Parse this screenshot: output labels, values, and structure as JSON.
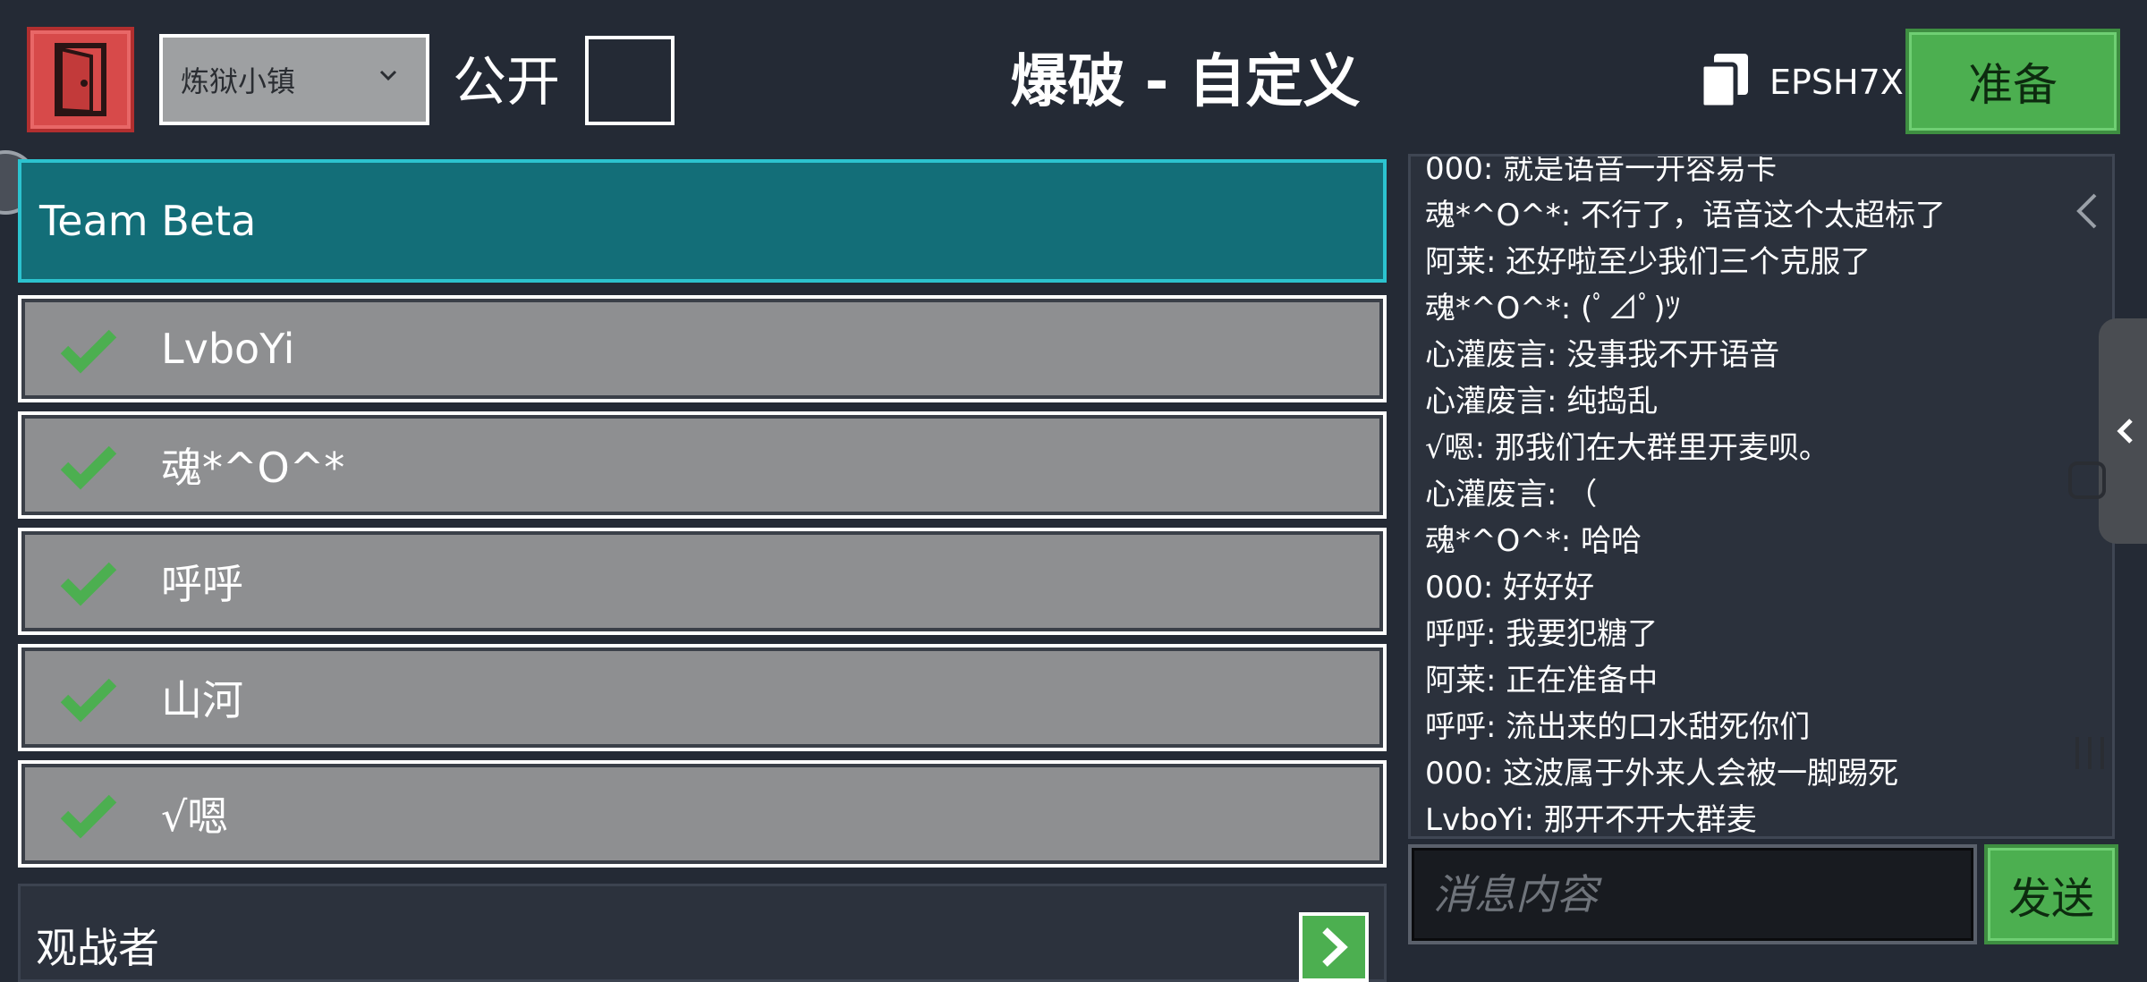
{
  "header": {
    "map_name": "炼狱小镇",
    "public_label": "公开",
    "public_checked": false,
    "mode_title": "爆破 - 自定义",
    "room_code": "EPSH7X",
    "ready_label": "准备"
  },
  "team": {
    "name": "Team Beta",
    "players": [
      {
        "name": "LvboYi",
        "ready": true
      },
      {
        "name": "魂*^O^*",
        "ready": true
      },
      {
        "name": "呼呼",
        "ready": true
      },
      {
        "name": "山河",
        "ready": true
      },
      {
        "name": "√嗯",
        "ready": true
      }
    ]
  },
  "spectators": {
    "label": "观战者"
  },
  "chat": {
    "messages": [
      "000: 就是语音一开容易卡",
      "魂*^O^*: 不行了，语音这个太超标了",
      "阿莱: 还好啦至少我们三个克服了",
      "魂*^O^*: (ﾟ⊿ﾟ)ﾂ",
      "心灌废言: 没事我不开语音",
      "心灌废言: 纯捣乱",
      "√嗯: 那我们在大群里开麦呗。",
      "心灌废言: （",
      "魂*^O^*: 哈哈",
      "000: 好好好",
      "呼呼: 我要犯糖了",
      "阿莱: 正在准备中",
      "呼呼: 流出来的口水甜死你们",
      "000: 这波属于外来人会被一脚踢死",
      "LvboYi: 那开不开大群麦"
    ],
    "input_placeholder": "消息内容",
    "send_label": "发送"
  },
  "colors": {
    "background": "#242a35",
    "team_header": "#136e78",
    "player_row": "#8e8f91",
    "accent_green": "#4caf50",
    "exit_red": "#d74a4a"
  },
  "icons": {
    "exit": "door-exit-icon",
    "copy": "copy-icon",
    "ready_check": "check-icon",
    "expand": "chevron-right-icon",
    "collapse": "chevron-left-icon"
  }
}
